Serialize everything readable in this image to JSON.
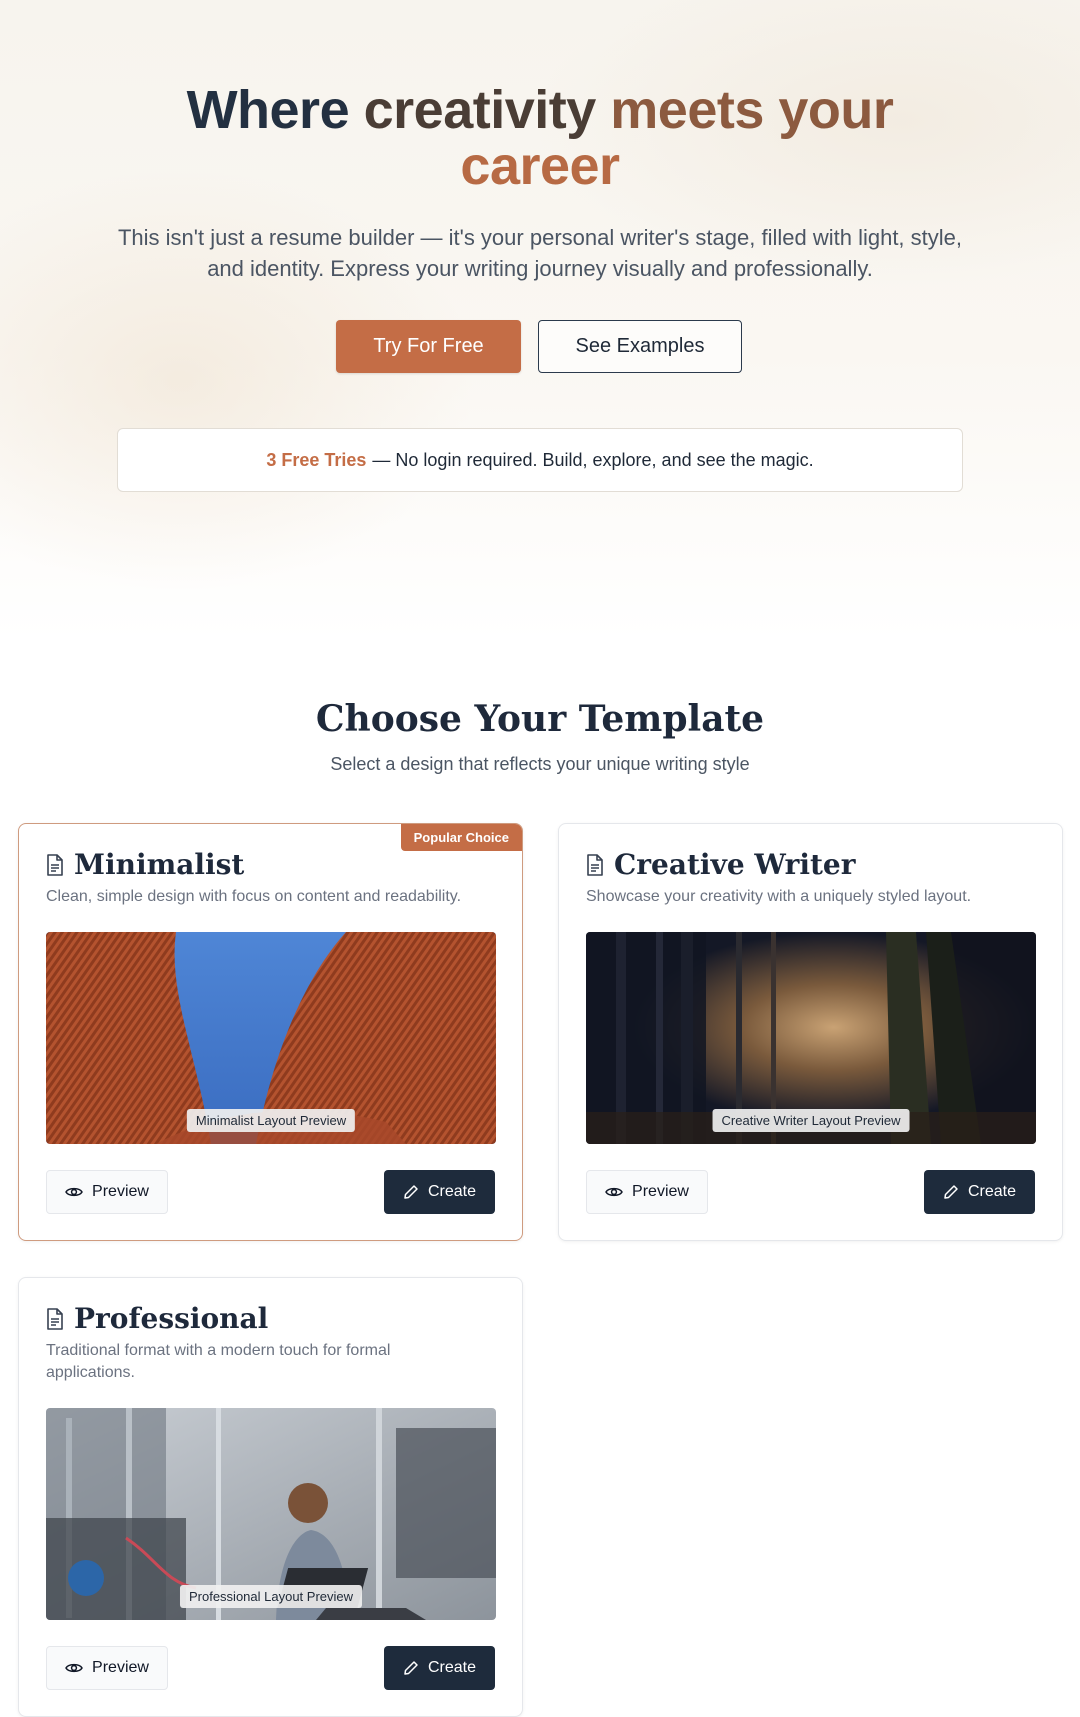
{
  "hero": {
    "title_w1": "Where",
    "title_w2": "creativity",
    "title_w3": "meets your",
    "title_w4": "career",
    "subtitle": "This isn't just a resume builder — it's your personal writer's stage, filled with light, style, and identity. Express your writing journey visually and professionally.",
    "primary_button": "Try For Free",
    "secondary_button": "See Examples",
    "notice_highlight": "3 Free Tries",
    "notice_text": "— No login required. Build, explore, and see the magic."
  },
  "templates": {
    "title": "Choose Your Template",
    "subtitle": "Select a design that reflects your unique writing style",
    "preview_label": "Preview",
    "create_label": "Create",
    "items": [
      {
        "name": "Minimalist",
        "badge": "Popular Choice",
        "description": "Clean, simple design with focus on content and readability.",
        "image_label": "Minimalist Layout Preview"
      },
      {
        "name": "Creative Writer",
        "description": "Showcase your creativity with a uniquely styled layout.",
        "image_label": "Creative Writer Layout Preview"
      },
      {
        "name": "Professional",
        "description": "Traditional format with a modern touch for formal applications.",
        "image_label": "Professional Layout Preview"
      }
    ]
  },
  "colors": {
    "accent": "#c46d46",
    "dark": "#1e2b3c",
    "popular_border": "#cf9b7f"
  },
  "icons": {
    "card_icon": "document-icon",
    "preview_icon": "eye-icon",
    "create_icon": "pencil-icon"
  }
}
